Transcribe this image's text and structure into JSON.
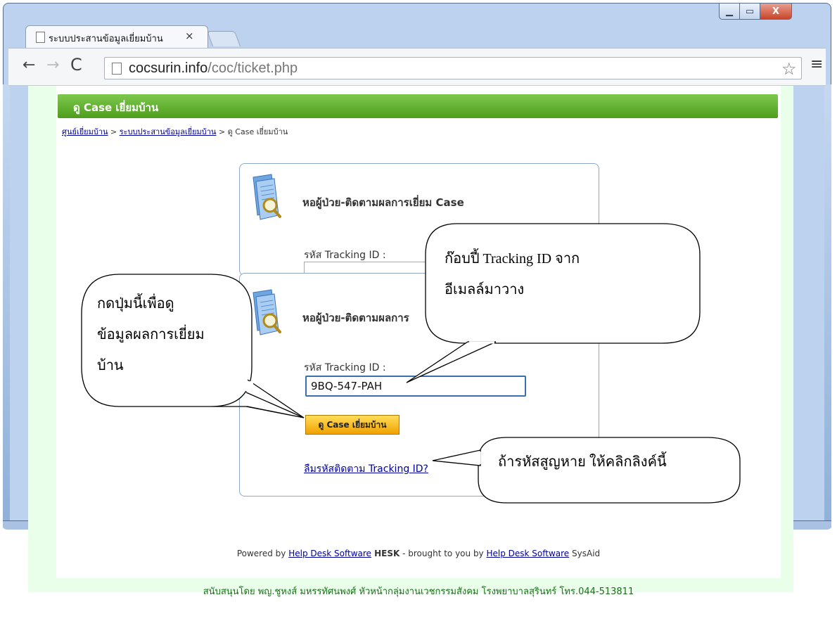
{
  "browser": {
    "tab_title": "ระบบประสานข้อมูลเยี่ยมบ้าน",
    "tab_close": "×",
    "url_host": "cocsurin.info",
    "url_path": "/coc/ticket.php",
    "window_min": "▁",
    "window_max": "▭",
    "window_close": "X",
    "back_icon": "←",
    "forward_icon": "→",
    "reload_icon": "C",
    "star_icon": "☆",
    "menu_icon": "≡"
  },
  "page": {
    "header_title": "ดู Case เยี่ยมบ้าน",
    "breadcrumb": {
      "link1": "ศูนย์เยี่ยมบ้าน",
      "sep1": " > ",
      "link2": "ระบบประสานข้อมูลเยี่ยมบ้าน",
      "sep2": " > ",
      "current": "ดู Case เยี่ยมบ้าน"
    },
    "box1": {
      "title": "หอผู้ป่วย-ติดตามผลการเยี่ยม Case",
      "tracking_label": "รหัส Tracking ID :"
    },
    "box2": {
      "title": "หอผู้ป่วย-ติดตามผลการ",
      "tracking_label": "รหัส Tracking ID :",
      "tracking_value": "9BQ-547-PAH",
      "view_button": "ดู Case เยี่ยมบ้าน",
      "forgot_link": "ลืมรหัสติดตาม Tracking ID?"
    },
    "footer": {
      "powered_by": "Powered by ",
      "link1": "Help Desk Software",
      "hesk": " HESK",
      "brought": " - brought to you by ",
      "link2": "Help Desk Software",
      "sysaid": " SysAid",
      "support": "สนับสนุนโดย พญ.ชูหงส์ มหรรทัศนพงศ์ หัวหน้ากลุ่มงานเวชกรรมสังคม โรงพยาบาลสุรินทร์ โทร.044-513811"
    }
  },
  "callouts": {
    "left": [
      "กดปุ่มนี้เพื่อดู",
      "ข้อมูลผลการเยี่ยม",
      "บ้าน"
    ],
    "right": [
      "ก๊อบปี้ Tracking ID จาก",
      "อีเมลล์มาวาง"
    ],
    "bottom": "ถ้ารหัสสูญหาย ให้คลิกลิงค์นี้"
  },
  "colors": {
    "header_green": "#5aa827",
    "page_bg": "#eaffea",
    "button_yellow": "#f7c21a",
    "link_blue": "#00009c"
  }
}
